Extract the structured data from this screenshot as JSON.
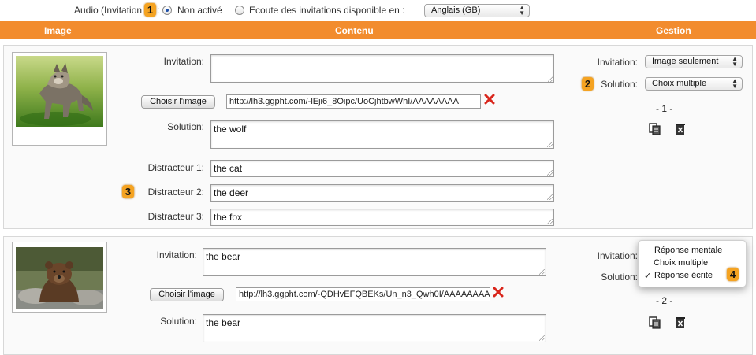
{
  "topbar": {
    "audio_label": "Audio (Invitation",
    "colon": ":",
    "option_off": "Non activé",
    "option_listen": "Ecoute des invitations disponible en :",
    "language": "Anglais (GB)"
  },
  "header": {
    "col_image": "Image",
    "col_content": "Contenu",
    "col_manage": "Gestion"
  },
  "badges": [
    "1",
    "2",
    "3",
    "4"
  ],
  "cards": [
    {
      "image": "wolf",
      "invitation_label": "Invitation:",
      "invitation_value": "",
      "choose_image_label": "Choisir l'image",
      "image_url": "http://lh3.ggpht.com/-lEji6_8Oipc/UoCjhtbwWhI/AAAAAAAA",
      "solution_label": "Solution:",
      "solution_value": "the wolf",
      "distractors": [
        {
          "label": "Distracteur 1:",
          "value": "the cat"
        },
        {
          "label": "Distracteur 2:",
          "value": "the deer"
        },
        {
          "label": "Distracteur 3:",
          "value": "the fox"
        }
      ],
      "manage": {
        "invitation_label": "Invitation:",
        "invitation_select": "Image seulement",
        "solution_label": "Solution:",
        "solution_select": "Choix multiple",
        "number": "- 1 -"
      }
    },
    {
      "image": "bear",
      "invitation_label": "Invitation:",
      "invitation_value": "the bear",
      "choose_image_label": "Choisir l'image",
      "image_url": "http://lh3.ggpht.com/-QDHvEFQBEKs/Un_n3_Qwh0I/AAAAAAAA",
      "solution_label": "Solution:",
      "solution_value": "the bear",
      "manage": {
        "invitation_label": "Invitation:",
        "solution_label": "Solution:",
        "number": "- 2 -",
        "menu_options": [
          "Réponse mentale",
          "Choix multiple",
          "Réponse écrite"
        ],
        "menu_selected": "Réponse écrite",
        "check": "✓"
      }
    }
  ],
  "colors": {
    "header": "#f28c2e",
    "badge": "#f5a321",
    "delete_x": "#d9261c"
  }
}
